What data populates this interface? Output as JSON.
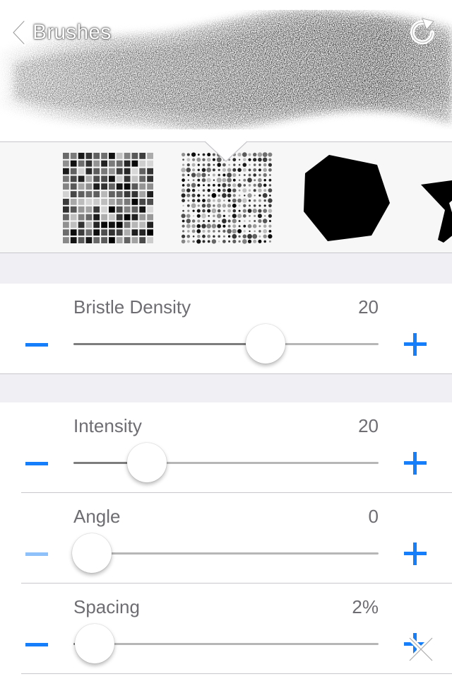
{
  "header": {
    "back_label": "Brushes",
    "back_icon": "chevron-left-icon",
    "reset_icon": "rotate-clockwise-icon"
  },
  "brush_tips": [
    {
      "name": "square-grid-tip",
      "icon": "square-grid-icon"
    },
    {
      "name": "dot-grid-tip",
      "icon": "dot-grid-icon",
      "selected": true
    },
    {
      "name": "heptagon-tip",
      "icon": "heptagon-icon"
    },
    {
      "name": "star-tip",
      "icon": "star-icon"
    }
  ],
  "sliders": {
    "bristle_density": {
      "label": "Bristle Density",
      "value": "20",
      "fraction": 0.63
    },
    "intensity": {
      "label": "Intensity",
      "value": "20",
      "fraction": 0.24
    },
    "angle": {
      "label": "Angle",
      "value": "0",
      "fraction": 0.06,
      "minus_disabled": true
    },
    "spacing": {
      "label": "Spacing",
      "value": "2%",
      "fraction": 0.07
    }
  },
  "colors": {
    "accent": "#147efb",
    "accent_disabled": "#8ec0f9",
    "label": "#6d6d72",
    "group_background": "#efeff4",
    "separator": "#c8c8cc"
  },
  "close_icon": "close-x-icon"
}
